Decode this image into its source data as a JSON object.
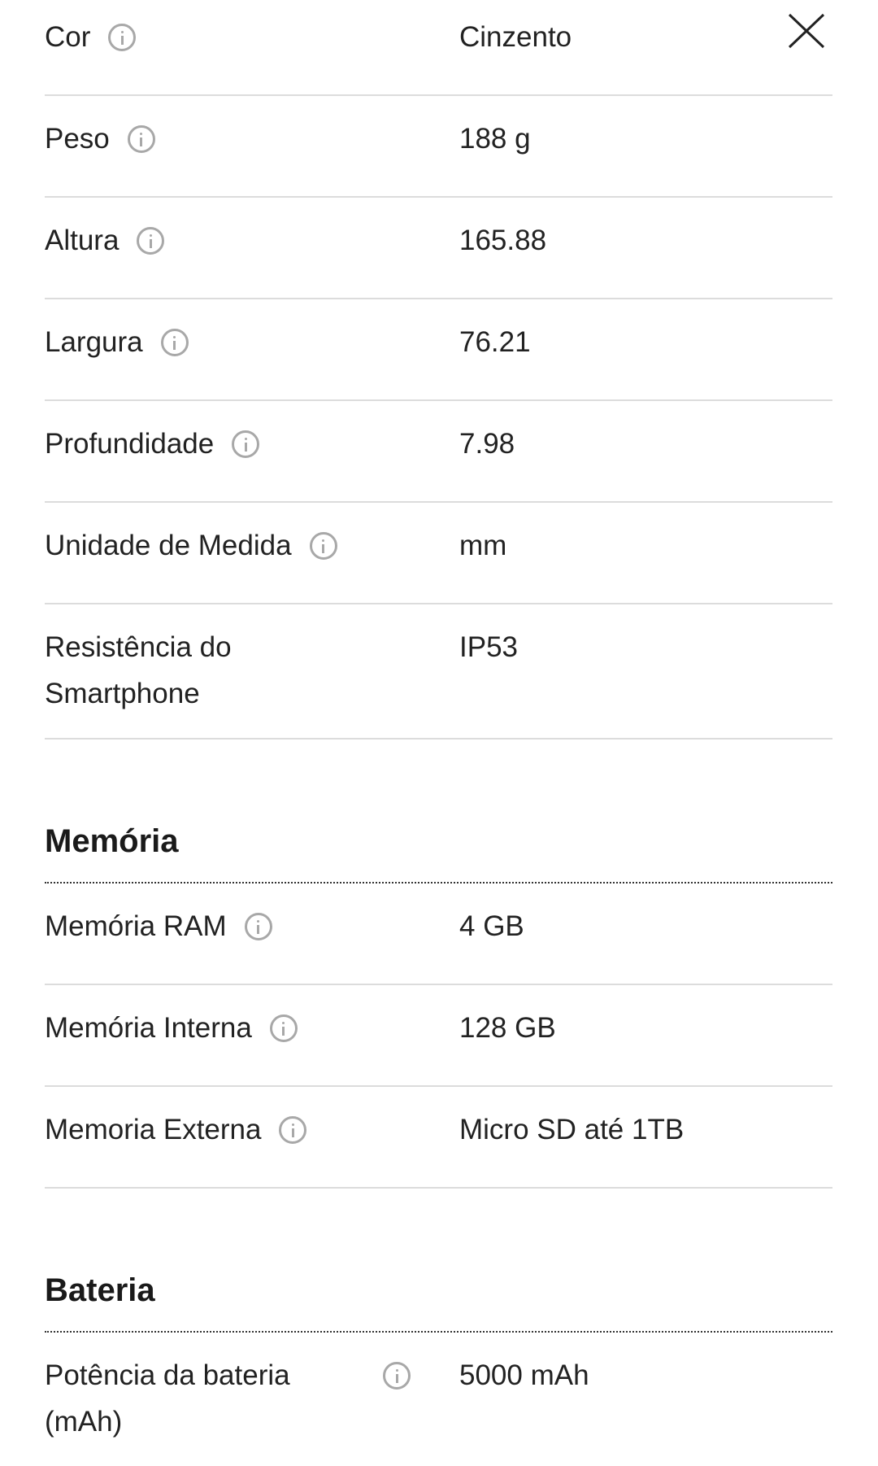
{
  "close_icon": "close-icon",
  "general_specs": [
    {
      "label": "Cor",
      "value": "Cinzento",
      "info": true
    },
    {
      "label": "Peso",
      "value": "188 g",
      "info": true
    },
    {
      "label": "Altura",
      "value": "165.88",
      "info": true
    },
    {
      "label": "Largura",
      "value": "76.21",
      "info": true
    },
    {
      "label": "Profundidade",
      "value": "7.98",
      "info": true
    },
    {
      "label": "Unidade de Medida",
      "value": "mm",
      "info": true
    },
    {
      "label": "Resistência do Smartphone",
      "value": "IP53",
      "info": false
    }
  ],
  "memory": {
    "title": "Memória",
    "specs": [
      {
        "label": "Memória RAM",
        "value": "4 GB"
      },
      {
        "label": "Memória Interna",
        "value": "128 GB"
      },
      {
        "label": "Memoria Externa",
        "value": "Micro SD até 1TB"
      }
    ]
  },
  "battery": {
    "title": "Bateria",
    "specs": [
      {
        "label": "Potência da bateria (mAh)",
        "value": "5000 mAh"
      }
    ]
  },
  "colors": {
    "text": "#222222",
    "divider": "#dcdcdc",
    "info_icon": "#a8a8a8"
  }
}
